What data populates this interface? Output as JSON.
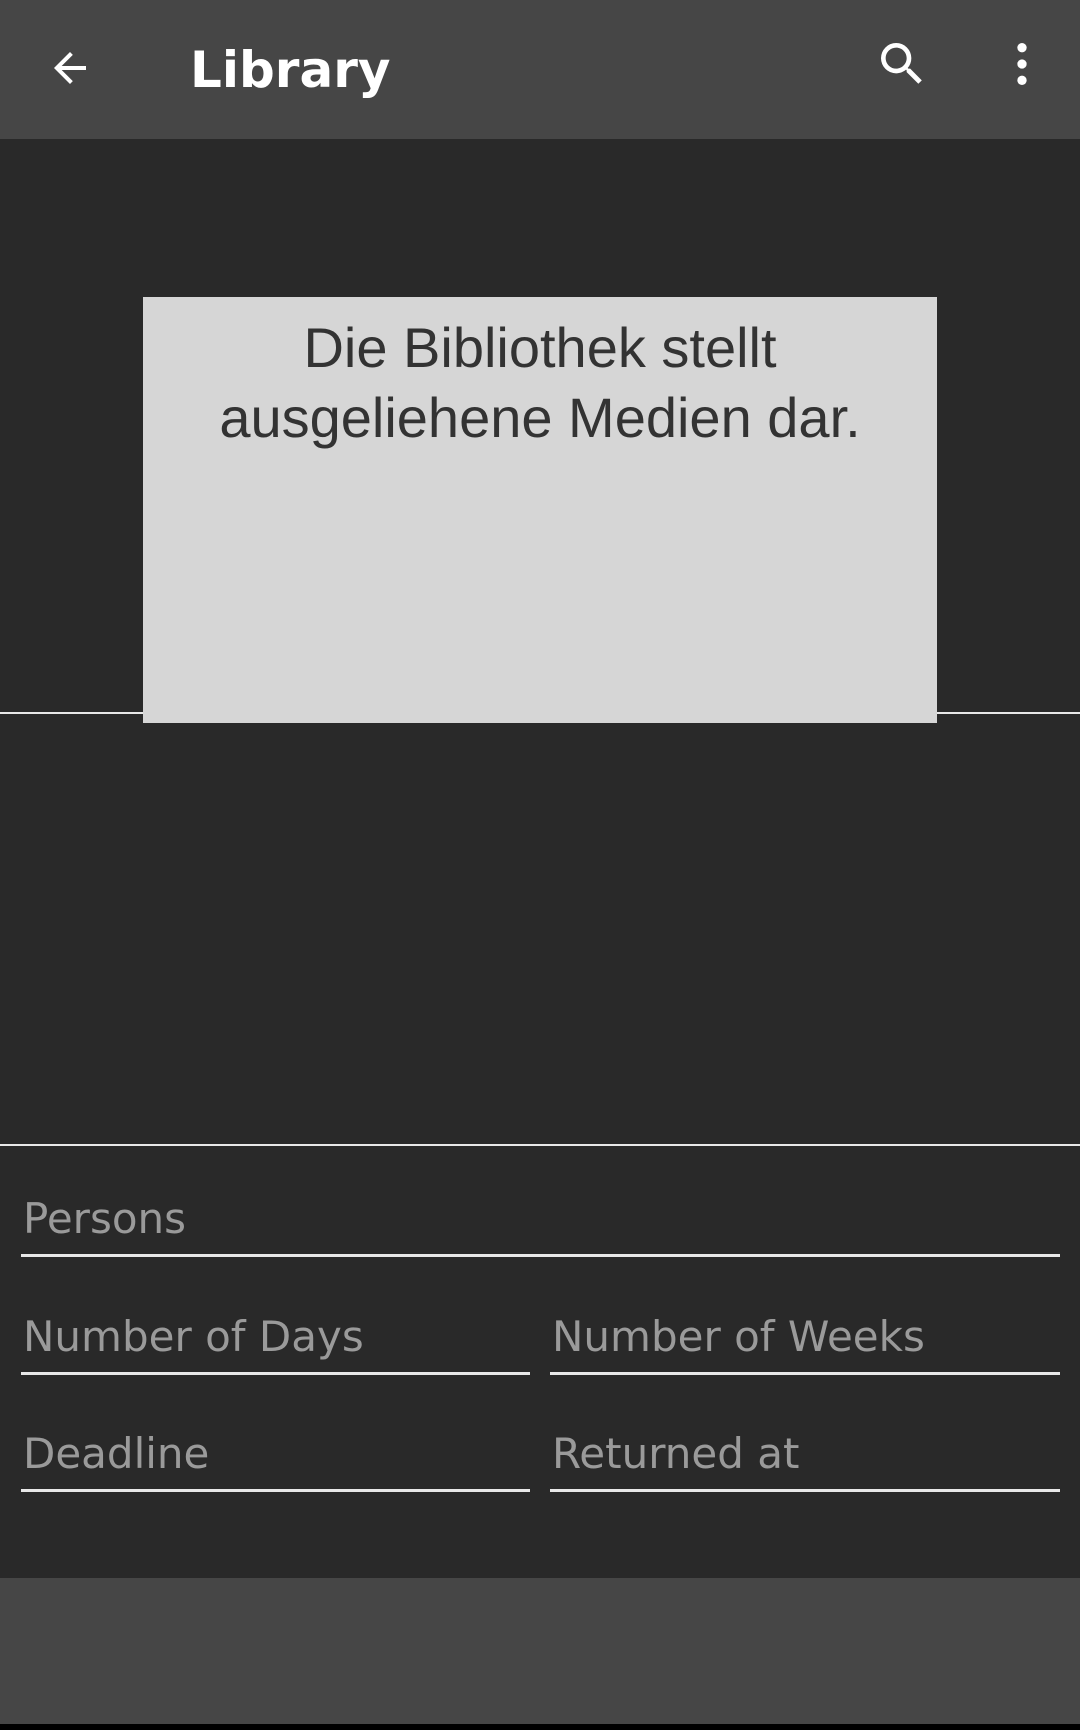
{
  "appbar": {
    "title": "Library",
    "back_icon": "arrow-back-icon",
    "search_icon": "search-icon",
    "overflow_icon": "more-vert-icon"
  },
  "media": {
    "placeholder_text": "Die Bibliothek stellt ausgeliehene Medien dar."
  },
  "form": {
    "persons_label": "Persons",
    "days_label": "Number of Days",
    "weeks_label": "Number of Weeks",
    "deadline_label": "Deadline",
    "returned_label": "Returned at"
  },
  "colors": {
    "appbar": "#464646",
    "background": "#292929",
    "card": "#d6d6d6",
    "hint_text": "#9a9a9a",
    "divider": "#e8e8e8"
  }
}
